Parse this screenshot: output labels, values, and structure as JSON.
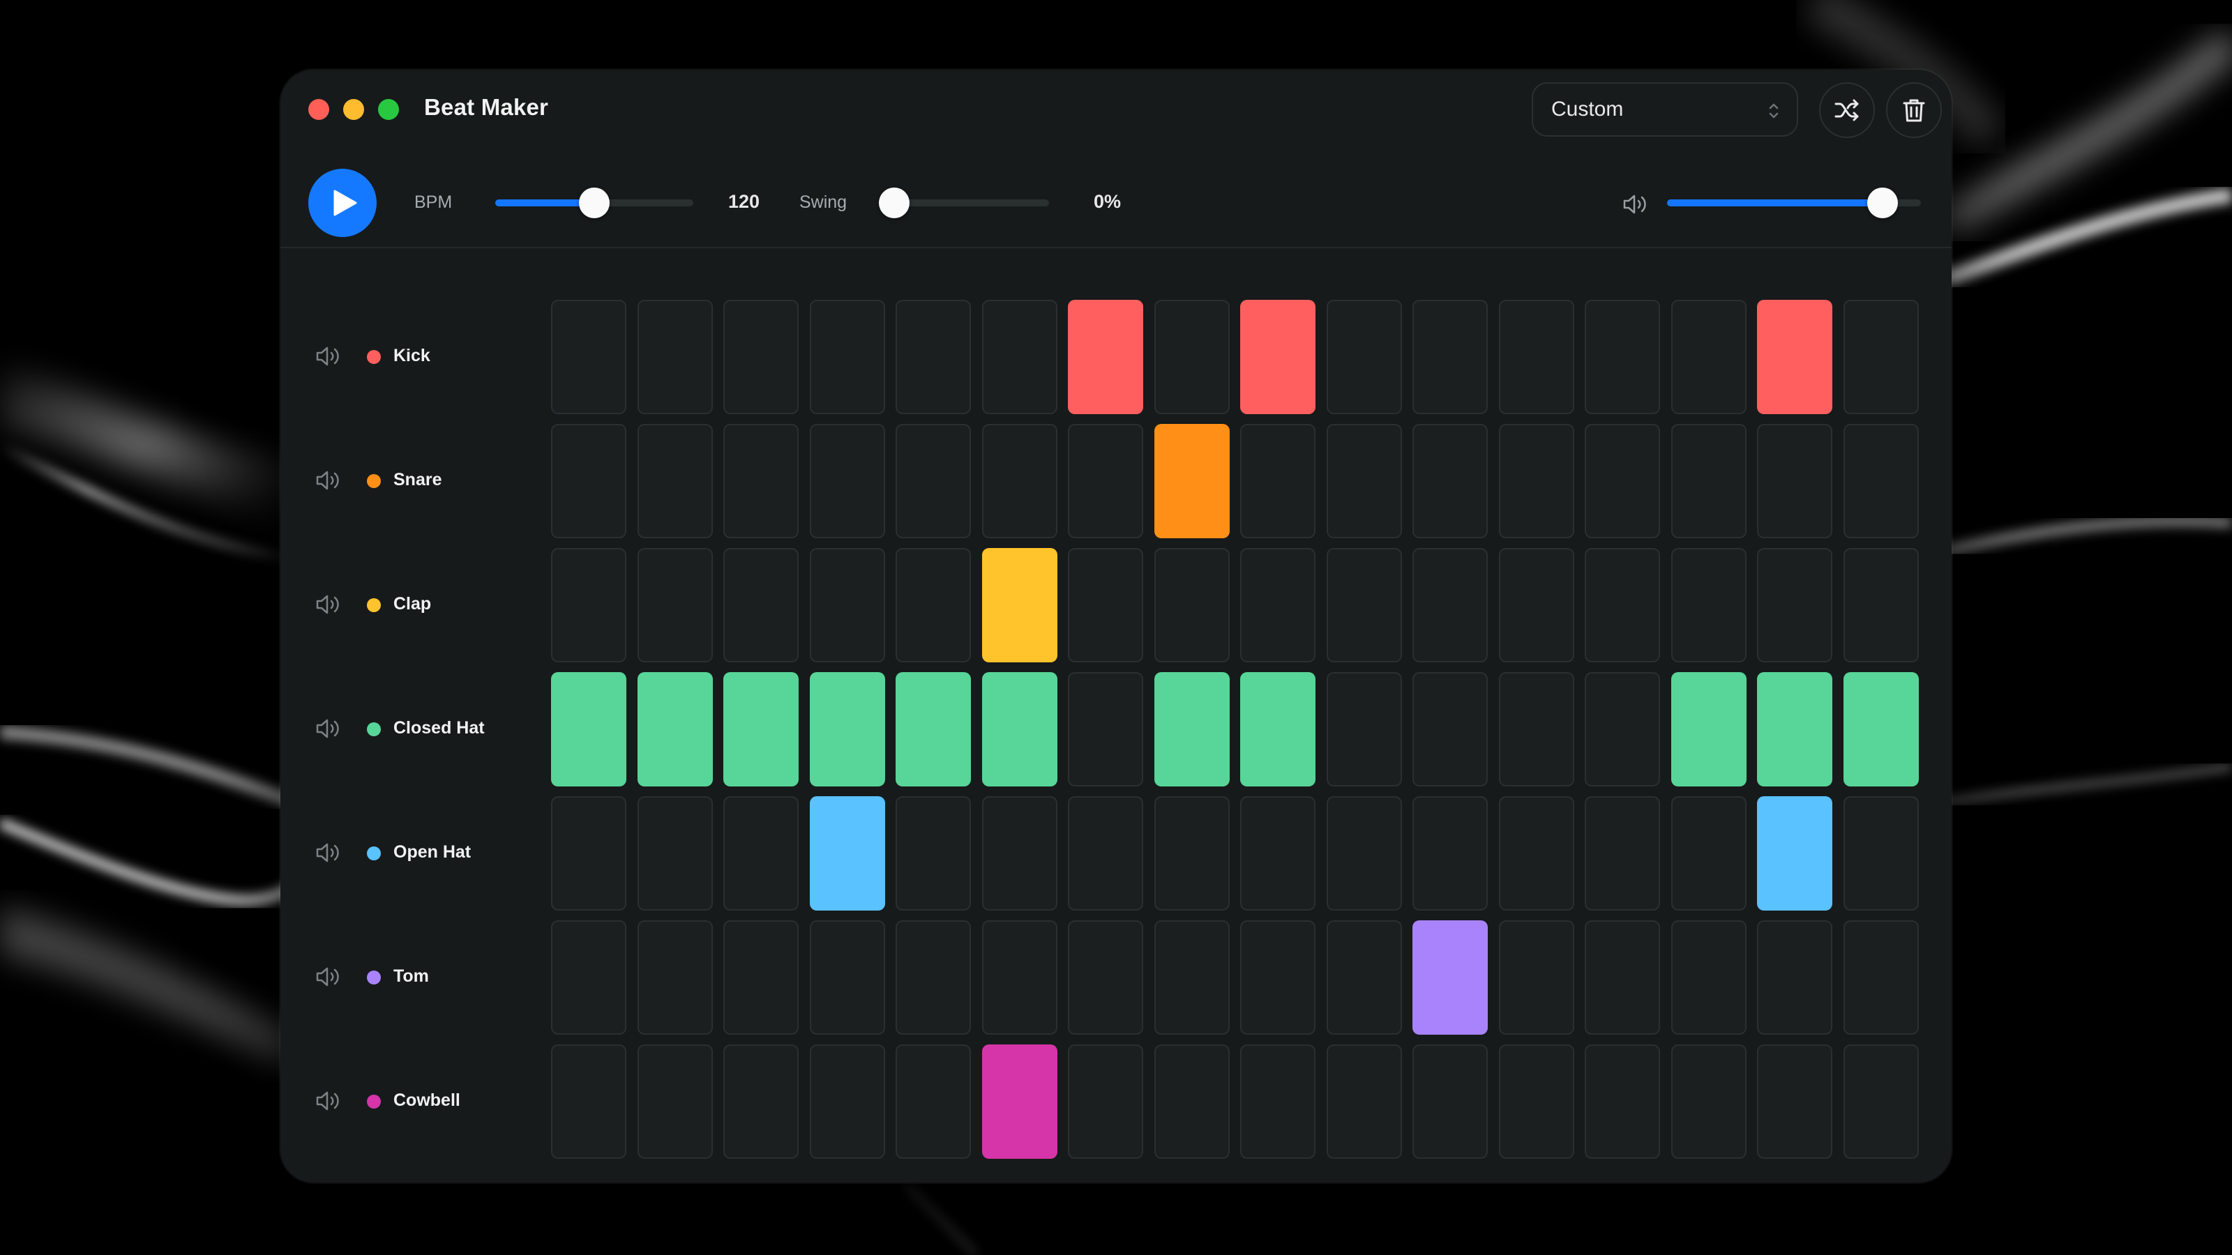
{
  "window": {
    "title": "Beat Maker"
  },
  "preset": {
    "selected": "Custom"
  },
  "header_icons": {
    "shuffle": "shuffle-icon",
    "delete": "trash-icon"
  },
  "transport": {
    "play_icon": "play-icon",
    "bpm_label": "BPM",
    "bpm_value": "120",
    "bpm_fraction": 0.5,
    "swing_label": "Swing",
    "swing_value": "0%",
    "swing_fraction": 0.0,
    "master_volume_icon": "speaker-icon",
    "master_volume_fraction": 0.85
  },
  "colors": {
    "accent": "#1479ff",
    "background": "#161a1b",
    "cell_off": "#1b1f20"
  },
  "steps_count": 16,
  "tracks": [
    {
      "name": "Kick",
      "color": "#ff5f5f",
      "steps": [
        0,
        0,
        0,
        0,
        0,
        0,
        1,
        0,
        1,
        0,
        0,
        0,
        0,
        0,
        1,
        0
      ]
    },
    {
      "name": "Snare",
      "color": "#ff8f17",
      "steps": [
        0,
        0,
        0,
        0,
        0,
        0,
        0,
        1,
        0,
        0,
        0,
        0,
        0,
        0,
        0,
        0
      ]
    },
    {
      "name": "Clap",
      "color": "#ffc42b",
      "steps": [
        0,
        0,
        0,
        0,
        0,
        1,
        0,
        0,
        0,
        0,
        0,
        0,
        0,
        0,
        0,
        0
      ]
    },
    {
      "name": "Closed Hat",
      "color": "#58d598",
      "steps": [
        1,
        1,
        1,
        1,
        1,
        1,
        0,
        1,
        1,
        0,
        0,
        0,
        0,
        1,
        1,
        1
      ]
    },
    {
      "name": "Open Hat",
      "color": "#5ac2ff",
      "steps": [
        0,
        0,
        0,
        1,
        0,
        0,
        0,
        0,
        0,
        0,
        0,
        0,
        0,
        0,
        1,
        0
      ]
    },
    {
      "name": "Tom",
      "color": "#a983fb",
      "steps": [
        0,
        0,
        0,
        0,
        0,
        0,
        0,
        0,
        0,
        0,
        1,
        0,
        0,
        0,
        0,
        0
      ]
    },
    {
      "name": "Cowbell",
      "color": "#d535a8",
      "steps": [
        0,
        0,
        0,
        0,
        0,
        1,
        0,
        0,
        0,
        0,
        0,
        0,
        0,
        0,
        0,
        0
      ]
    }
  ]
}
